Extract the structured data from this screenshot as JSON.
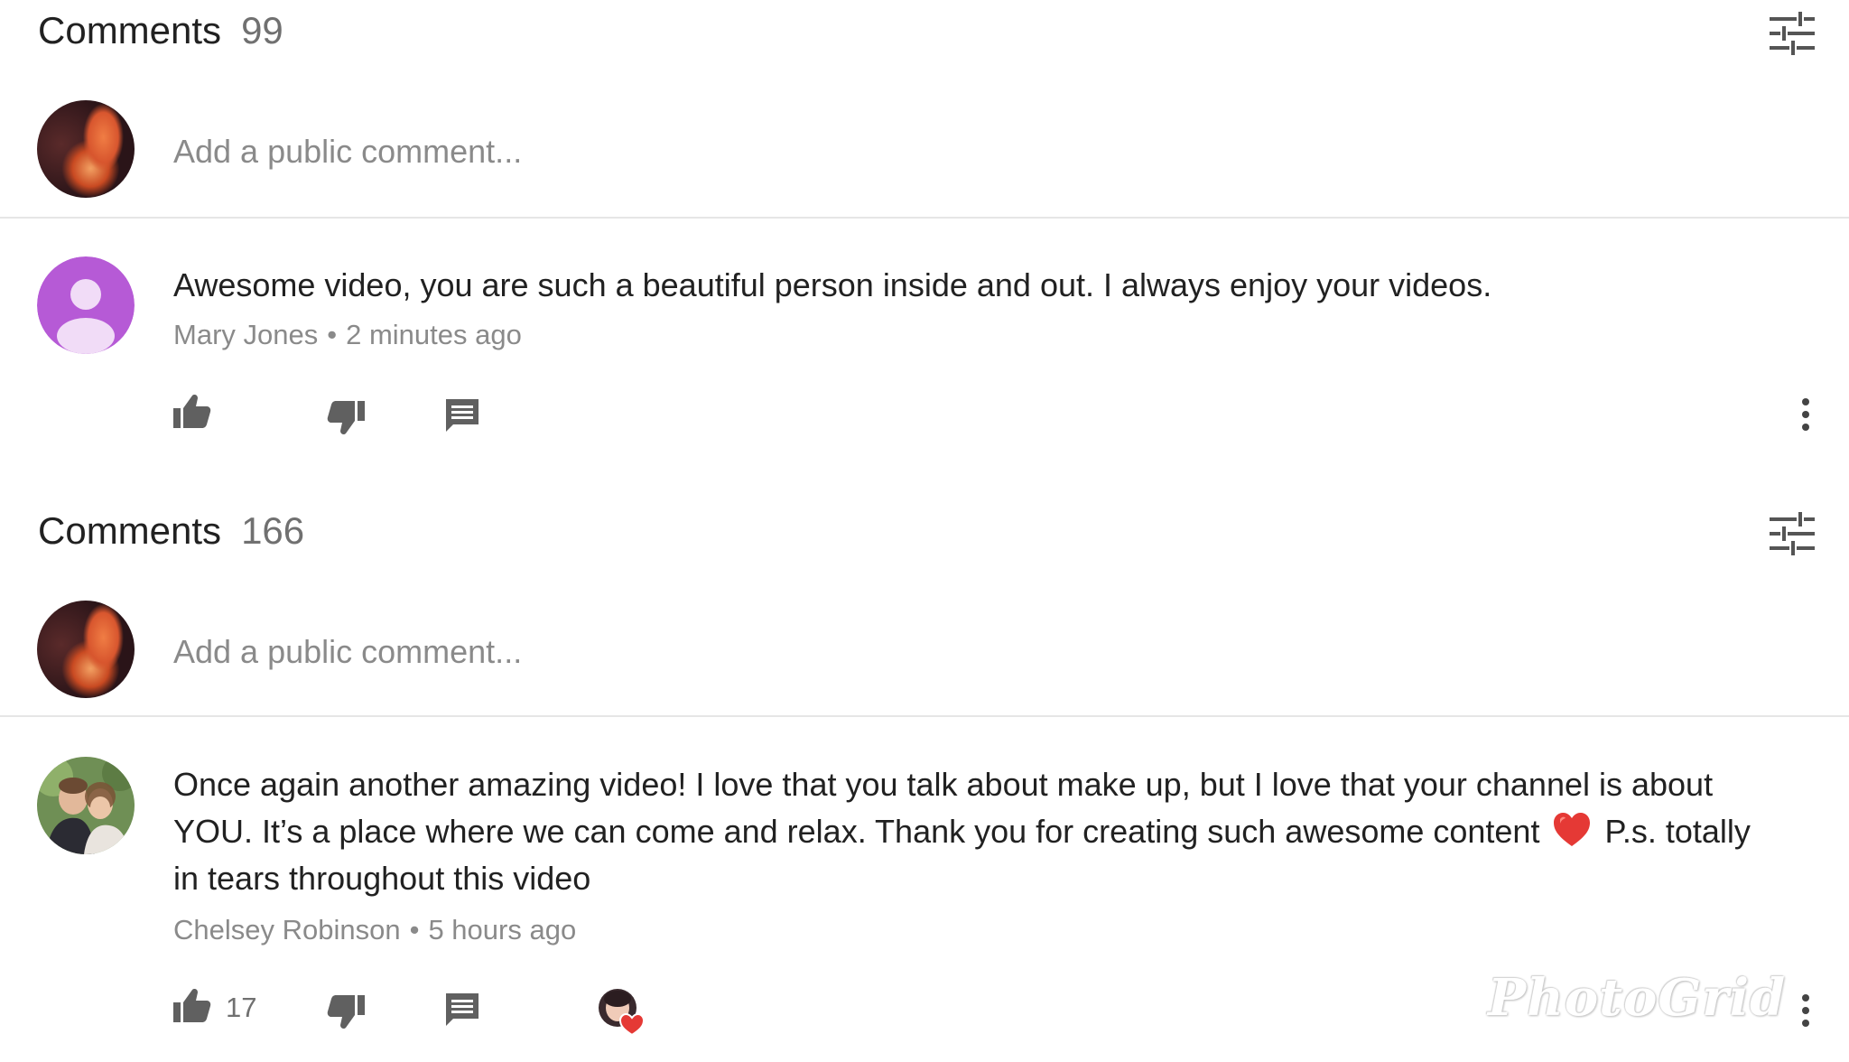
{
  "section1": {
    "title": "Comments",
    "count": "99",
    "add_comment_placeholder": "Add a public comment...",
    "comment": {
      "text": "Awesome video, you are such a beautiful person inside and out. I always enjoy your videos.",
      "author": "Mary Jones",
      "time": "2 minutes ago",
      "avatar_color": "#b65ad6"
    }
  },
  "section2": {
    "title": "Comments",
    "count": "166",
    "add_comment_placeholder": "Add a public comment...",
    "comment": {
      "line1": "Once again another amazing video! I love that you talk about make up, but I love that your channel is about",
      "line2_before": "YOU. It’s a place where we can come and relax. Thank you for creating such awesome content",
      "line2_after": "P.s. totally",
      "line3": "in tears throughout this video",
      "author": "Chelsey Robinson",
      "time": "5 hours ago",
      "likes": "17"
    }
  },
  "separator": "•",
  "watermark": "PhotoGrid",
  "icons": {
    "sort": "sort-sliders-icon",
    "like": "thumbs-up-icon",
    "dislike": "thumbs-down-icon",
    "reply": "reply-comment-icon",
    "more": "more-vertical-icon",
    "heart": "red-heart-icon",
    "creator_heart": "creator-heart-badge"
  },
  "colors": {
    "icon": "#606060",
    "meta_text": "#8a8a8a",
    "heart": "#e53935"
  }
}
